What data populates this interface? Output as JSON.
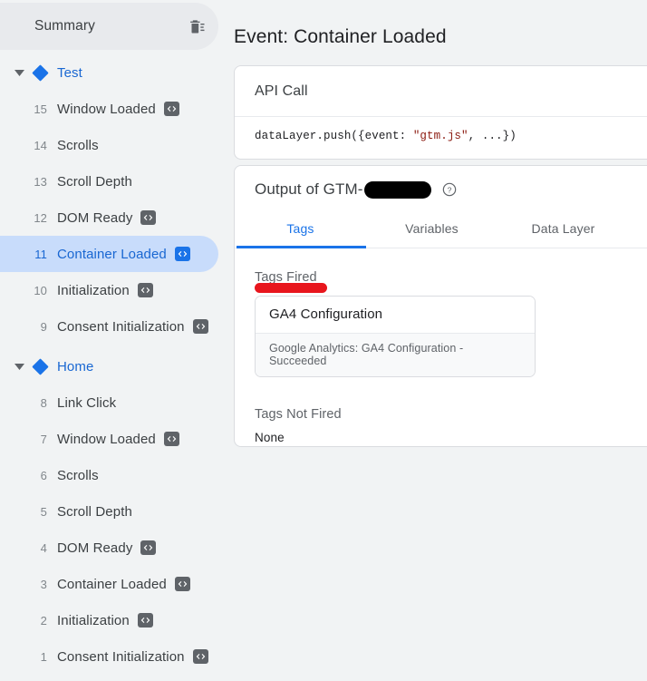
{
  "sidebar": {
    "summary": {
      "label": "Summary",
      "clear_icon": "trash-icon"
    },
    "groups": [
      {
        "label": "Test",
        "expanded": true,
        "events": [
          {
            "num": "15",
            "name": "Window Loaded",
            "has_code_badge": true,
            "selected": false
          },
          {
            "num": "14",
            "name": "Scrolls",
            "has_code_badge": false,
            "selected": false
          },
          {
            "num": "13",
            "name": "Scroll Depth",
            "has_code_badge": false,
            "selected": false
          },
          {
            "num": "12",
            "name": "DOM Ready",
            "has_code_badge": true,
            "selected": false
          },
          {
            "num": "11",
            "name": "Container Loaded",
            "has_code_badge": true,
            "selected": true
          },
          {
            "num": "10",
            "name": "Initialization",
            "has_code_badge": true,
            "selected": false
          },
          {
            "num": "9",
            "name": "Consent Initialization",
            "has_code_badge": true,
            "selected": false
          }
        ]
      },
      {
        "label": "Home",
        "expanded": true,
        "events": [
          {
            "num": "8",
            "name": "Link Click",
            "has_code_badge": false,
            "selected": false
          },
          {
            "num": "7",
            "name": "Window Loaded",
            "has_code_badge": true,
            "selected": false
          },
          {
            "num": "6",
            "name": "Scrolls",
            "has_code_badge": false,
            "selected": false
          },
          {
            "num": "5",
            "name": "Scroll Depth",
            "has_code_badge": false,
            "selected": false
          },
          {
            "num": "4",
            "name": "DOM Ready",
            "has_code_badge": true,
            "selected": false
          },
          {
            "num": "3",
            "name": "Container Loaded",
            "has_code_badge": true,
            "selected": false
          },
          {
            "num": "2",
            "name": "Initialization",
            "has_code_badge": true,
            "selected": false
          },
          {
            "num": "1",
            "name": "Consent Initialization",
            "has_code_badge": true,
            "selected": false
          }
        ]
      }
    ]
  },
  "main": {
    "page_title": "Event: Container Loaded",
    "api_card": {
      "title": "API Call",
      "code_prefix": "dataLayer.push({event: ",
      "code_string": "\"gtm.js\"",
      "code_suffix": ", ...})"
    },
    "output_card": {
      "title_prefix": "Output of GTM-",
      "redacted": true,
      "help_icon": "help-circle-icon",
      "tabs": [
        {
          "label": "Tags",
          "active": true
        },
        {
          "label": "Variables",
          "active": false
        },
        {
          "label": "Data Layer",
          "active": false
        }
      ],
      "tags_fired_label": "Tags Fired",
      "tags_fired": [
        {
          "name": "GA4 Configuration",
          "status": "Google Analytics: GA4 Configuration - Succeeded"
        }
      ],
      "tags_not_fired_label": "Tags Not Fired",
      "tags_not_fired_value": "None"
    }
  },
  "colors": {
    "accent": "#1a73e8",
    "selected_bg": "#c8dcfb",
    "sidebar_bg": "#f1f3f4",
    "annotation_red": "#e8161d",
    "code_string": "#8b1a10"
  }
}
